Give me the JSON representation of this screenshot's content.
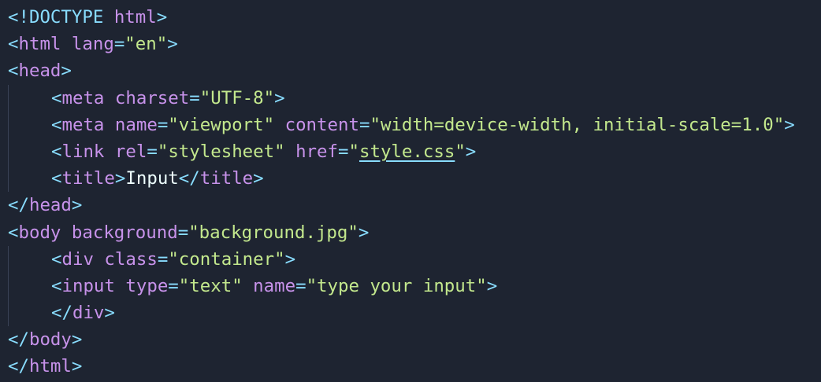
{
  "editor": {
    "lines": [
      {
        "tokens": [
          {
            "t": "<!DOCTYPE ",
            "c": "bracket"
          },
          {
            "t": "html",
            "c": "tag"
          },
          {
            "t": ">",
            "c": "bracket"
          }
        ],
        "indent": 0
      },
      {
        "tokens": [
          {
            "t": "<",
            "c": "bracket"
          },
          {
            "t": "html",
            "c": "tagname"
          },
          {
            "t": " ",
            "c": "text"
          },
          {
            "t": "lang",
            "c": "attr"
          },
          {
            "t": "=",
            "c": "eq"
          },
          {
            "t": "\"",
            "c": "q"
          },
          {
            "t": "en",
            "c": "str"
          },
          {
            "t": "\"",
            "c": "q"
          },
          {
            "t": ">",
            "c": "bracket"
          }
        ],
        "indent": 0
      },
      {
        "tokens": [
          {
            "t": "<",
            "c": "bracket"
          },
          {
            "t": "head",
            "c": "tagname"
          },
          {
            "t": ">",
            "c": "bracket"
          }
        ],
        "indent": 0
      },
      {
        "tokens": [
          {
            "t": "<",
            "c": "bracket"
          },
          {
            "t": "meta",
            "c": "tagname"
          },
          {
            "t": " ",
            "c": "text"
          },
          {
            "t": "charset",
            "c": "attr"
          },
          {
            "t": "=",
            "c": "eq"
          },
          {
            "t": "\"",
            "c": "q"
          },
          {
            "t": "UTF-8",
            "c": "str"
          },
          {
            "t": "\"",
            "c": "q"
          },
          {
            "t": ">",
            "c": "bracket"
          }
        ],
        "indent": 1
      },
      {
        "tokens": [
          {
            "t": "<",
            "c": "bracket"
          },
          {
            "t": "meta",
            "c": "tagname"
          },
          {
            "t": " ",
            "c": "text"
          },
          {
            "t": "name",
            "c": "attr"
          },
          {
            "t": "=",
            "c": "eq"
          },
          {
            "t": "\"",
            "c": "q"
          },
          {
            "t": "viewport",
            "c": "str"
          },
          {
            "t": "\"",
            "c": "q"
          },
          {
            "t": " ",
            "c": "text"
          },
          {
            "t": "content",
            "c": "attr"
          },
          {
            "t": "=",
            "c": "eq"
          },
          {
            "t": "\"",
            "c": "q"
          },
          {
            "t": "width=device-width, initial-scale=1.0",
            "c": "str"
          },
          {
            "t": "\"",
            "c": "q"
          },
          {
            "t": ">",
            "c": "bracket"
          }
        ],
        "indent": 1
      },
      {
        "tokens": [
          {
            "t": "<",
            "c": "bracket"
          },
          {
            "t": "link",
            "c": "tagname"
          },
          {
            "t": " ",
            "c": "text"
          },
          {
            "t": "rel",
            "c": "attr"
          },
          {
            "t": "=",
            "c": "eq"
          },
          {
            "t": "\"",
            "c": "q"
          },
          {
            "t": "stylesheet",
            "c": "str"
          },
          {
            "t": "\"",
            "c": "q"
          },
          {
            "t": " ",
            "c": "text"
          },
          {
            "t": "href",
            "c": "attr"
          },
          {
            "t": "=",
            "c": "eq"
          },
          {
            "t": "\"",
            "c": "q"
          },
          {
            "t": "style.css",
            "c": "link"
          },
          {
            "t": "\"",
            "c": "q"
          },
          {
            "t": ">",
            "c": "bracket"
          }
        ],
        "indent": 1
      },
      {
        "tokens": [
          {
            "t": "<",
            "c": "bracket"
          },
          {
            "t": "title",
            "c": "tagname"
          },
          {
            "t": ">",
            "c": "bracket"
          },
          {
            "t": "Input",
            "c": "text"
          },
          {
            "t": "</",
            "c": "bracket"
          },
          {
            "t": "title",
            "c": "tagname"
          },
          {
            "t": ">",
            "c": "bracket"
          }
        ],
        "indent": 1
      },
      {
        "tokens": [
          {
            "t": "</",
            "c": "bracket"
          },
          {
            "t": "head",
            "c": "tagname"
          },
          {
            "t": ">",
            "c": "bracket"
          }
        ],
        "indent": 0
      },
      {
        "tokens": [
          {
            "t": "<",
            "c": "bracket"
          },
          {
            "t": "body",
            "c": "tagname"
          },
          {
            "t": " ",
            "c": "text"
          },
          {
            "t": "background",
            "c": "attr"
          },
          {
            "t": "=",
            "c": "eq"
          },
          {
            "t": "\"",
            "c": "q"
          },
          {
            "t": "background.jpg",
            "c": "str"
          },
          {
            "t": "\"",
            "c": "q"
          },
          {
            "t": ">",
            "c": "bracket"
          }
        ],
        "indent": 0
      },
      {
        "tokens": [
          {
            "t": "<",
            "c": "bracket"
          },
          {
            "t": "div",
            "c": "tagname"
          },
          {
            "t": " ",
            "c": "text"
          },
          {
            "t": "class",
            "c": "attr"
          },
          {
            "t": "=",
            "c": "eq"
          },
          {
            "t": "\"",
            "c": "q"
          },
          {
            "t": "container",
            "c": "str"
          },
          {
            "t": "\"",
            "c": "q"
          },
          {
            "t": ">",
            "c": "bracket"
          }
        ],
        "indent": 1
      },
      {
        "tokens": [
          {
            "t": "<",
            "c": "bracket"
          },
          {
            "t": "input",
            "c": "tagname"
          },
          {
            "t": " ",
            "c": "text"
          },
          {
            "t": "type",
            "c": "attr"
          },
          {
            "t": "=",
            "c": "eq"
          },
          {
            "t": "\"",
            "c": "q"
          },
          {
            "t": "text",
            "c": "str"
          },
          {
            "t": "\"",
            "c": "q"
          },
          {
            "t": " ",
            "c": "text"
          },
          {
            "t": "name",
            "c": "attr"
          },
          {
            "t": "=",
            "c": "eq"
          },
          {
            "t": "\"",
            "c": "q"
          },
          {
            "t": "type your input",
            "c": "str"
          },
          {
            "t": "\"",
            "c": "q"
          },
          {
            "t": ">",
            "c": "bracket"
          }
        ],
        "indent": 1
      },
      {
        "tokens": [
          {
            "t": "</",
            "c": "bracket"
          },
          {
            "t": "div",
            "c": "tagname"
          },
          {
            "t": ">",
            "c": "bracket"
          }
        ],
        "indent": 1
      },
      {
        "tokens": [
          {
            "t": "</",
            "c": "bracket"
          },
          {
            "t": "body",
            "c": "tagname"
          },
          {
            "t": ">",
            "c": "bracket"
          }
        ],
        "indent": 0
      },
      {
        "tokens": [
          {
            "t": "</",
            "c": "bracket"
          },
          {
            "t": "html",
            "c": "tagname"
          },
          {
            "t": ">",
            "c": "bracket"
          }
        ],
        "indent": 0
      }
    ]
  },
  "colors": {
    "background": "#1e2431",
    "bracket": "#89ddff",
    "tag": "#c792ea",
    "attr": "#c792ea",
    "string": "#c3e88d",
    "text": "#eeffff",
    "indent_guide": "#3a4256"
  }
}
